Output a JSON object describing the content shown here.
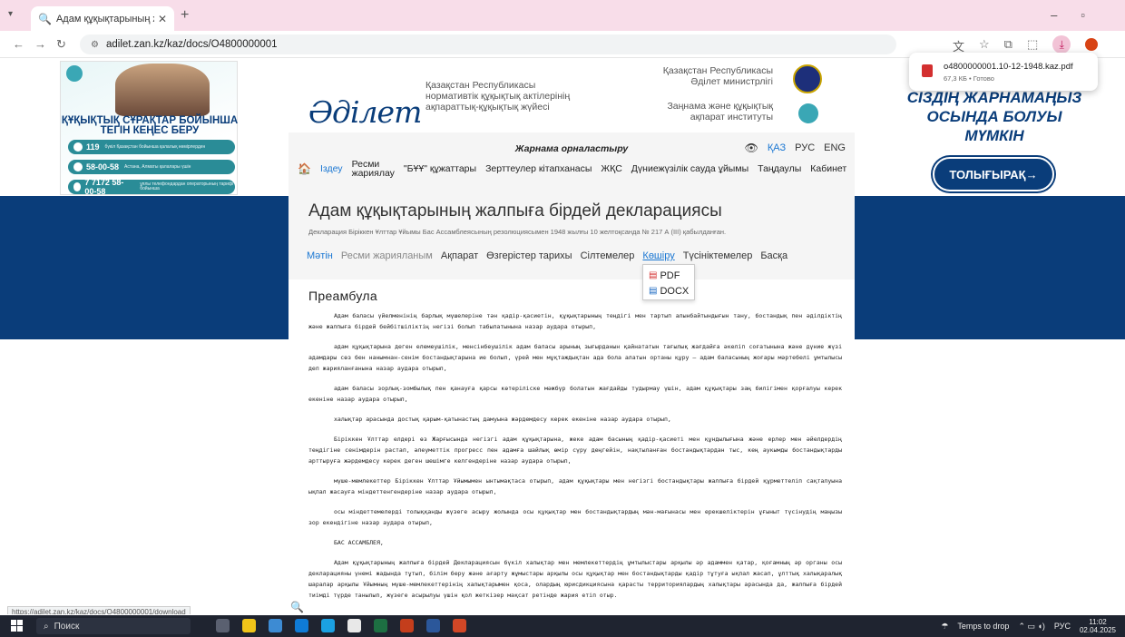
{
  "browser": {
    "tab_title": "Адам құқықтарының жалпыға",
    "url": "adilet.zan.kz/kaz/docs/O4800000001",
    "new_tab": "+",
    "tab_close": "✕"
  },
  "download": {
    "filename": "o4800000001.10-12-1948.kaz.pdf",
    "status": "67,3 КБ • Готово"
  },
  "ads": {
    "left_title_line1": "ҚҰҚЫҚТЫҚ СҰРАҚТАР БОЙЫНША",
    "left_title_line2": "ТЕГІН КЕҢЕС БЕРУ",
    "phones": [
      {
        "number": "119",
        "note": "бүкіл Қазақстан бойынша қалалық нөмірлерден"
      },
      {
        "number": "58-00-58",
        "note": "Астана, Алматы қалалары үшін"
      },
      {
        "number": "7 7172 58-00-58",
        "note": "ұялы телефондардан операторының тарифі бойынша"
      }
    ],
    "right_line1": "СІЗДІҢ ЖАРНАМАҢЫЗ",
    "right_line2": "ОСЫНДА БОЛУЫ",
    "right_line3": "МҮМКІН",
    "right_button": "ТОЛЫҒЫРАҚ→"
  },
  "header": {
    "brand": "Әділет",
    "sub_line1": "Қазақстан Республикасы",
    "sub_line2": "нормативтік құқықтық актілерінің",
    "sub_line3": "ақпараттық-құқықтық жүйесі",
    "ministry_line1": "Қазақстан Республикасы",
    "ministry_line2": "Әділет министрлігі",
    "institute_line1": "Заңнама және құқықтық",
    "institute_line2": "ақпарат институты"
  },
  "nav": {
    "advert": "Жарнама орналастыру",
    "langs": [
      "ҚАЗ",
      "РУС",
      "ENG"
    ],
    "search": "Іздеу",
    "official_line1": "Ресми",
    "official_line2": "жариялау",
    "items": [
      "\"БҰҰ\" құжаттары",
      "Зерттеулер кітапханасы",
      "ЖҚС",
      "Дүниежүзілік сауда ұйымы",
      "Таңдаулы",
      "Кабинет"
    ]
  },
  "document": {
    "title": "Адам құқықтарының жалпыға бірдей декларациясы",
    "description": "Декларация Біріккен Ұлттар Ұйымы Бас Ассамблеясының резолюциясымен 1948 жылғы 10 желтоқсанда № 217 А (III) қабылданған.",
    "tabs": [
      "Мәтін",
      "Ресми жарияланым",
      "Ақпарат",
      "Өзгерістер тарихы",
      "Сілтемелер",
      "Көшіру",
      "Түсініктемелер",
      "Басқа"
    ],
    "dropdown": [
      "PDF",
      "DOCX"
    ],
    "section": "Преамбула",
    "paragraphs": [
      "Адам баласы үйелменінің барлық мүшелеріне тән қадір-қасиетін, құқықтарының теңдігі мен тартып алынбайтындығын тану, бостандық пен әділдіктің және жалпыға бірдей бейбітшіліктің негізі болып табылатынына назар аудара отырып,",
      "адам құқықтарына деген елемеушілік, менсінбеушілік адам баласы арының зығырданын қайнататын тағылық жағдайға әкеліп соғатынына және дүние жүзі адамдары сөз бен нанымнан-сенім бостандықтарына ие болып, үрей мен мұқтаждықтан ада бола алатын ортаны құру – адам баласының жоғары мәртебелі ұмтылысы деп жарияланғанына назар аудара отырып,",
      "адам баласы зорлық-зомбылық пен қанауға қарсы көтеріліске мәжбүр болатын жағдайды тудырмау үшін, адам құқықтары заң билігімен қорғалуы керек екеніне назар аудара отырып,",
      "халықтар арасында достық қарым-қатынастың дамуына жәрдемдесу керек екеніне назар аудара отырып,",
      "Біріккен Ұлттар елдері өз Жарғысында негізгі адам құқықтарына, жеке адам басының қадір-қасиеті мен құндылығына және ерлер мен әйелдердің теңдігіне сенімдерін растап, әлеуметтік прогресс пен адамға шайлық өмір сүру деңгейін, нақтыланған бостандықтардан тыс, кең аукымды бостандықтарды арттыруға жәрдемдесу керек деген шешімге келгендеріне назар аудара отырып,",
      "мүше-мемлекеттер Біріккен Ұлттар Ұйымымен ынтымақтаса отырып, адам құқықтары мен негізгі бостандықтары жалпыға бірдей құрметтеліп сақталуына ықпал жасауға міндеттенгендеріне назар аудара отырып,",
      "осы міндеттемелерді толыққанды жүзеге асыру жолында осы құқықтар мен бостандықтардың мән-мағынасы мен ерекшеліктерін ұғыныт түсінудің маңызы зор екендігіне назар аудара отырып,",
      "БАС АССАМБЛЕЯ,",
      "Адам құқықтарының жалпыға бірдей Декларациясын бүкіл халықтар мен мемлекеттердің ұмтылыстары арқылы әр адаммен қатар, қоғамның әр органы осы декларацияны үнемі жадында тұтып, білім беру және ағарту жұмыстары арқылы осы құқықтар мен бостандықтарды қадір тұтуға ықпал жасап, ұлттық халықаралық шаралар арқылы Ұйымның мүше-мемлекеттерінің халықтарымен қоса, олардың юрисдикциясына қарасты территориялардың халықтары арасында да, жалпыға бірдей тиімді түрде танылып, жүзеге асырылуы үшін қол жеткізер мақсат ретінде жария етіп отыр."
    ]
  },
  "status_url": "https://adilet.zan.kz/kaz/docs/O4800000001/download",
  "taskbar": {
    "search": "Поиск",
    "weather": "Temps to drop",
    "lang": "РУС",
    "time": "11:02",
    "date": "02.04.2025"
  }
}
